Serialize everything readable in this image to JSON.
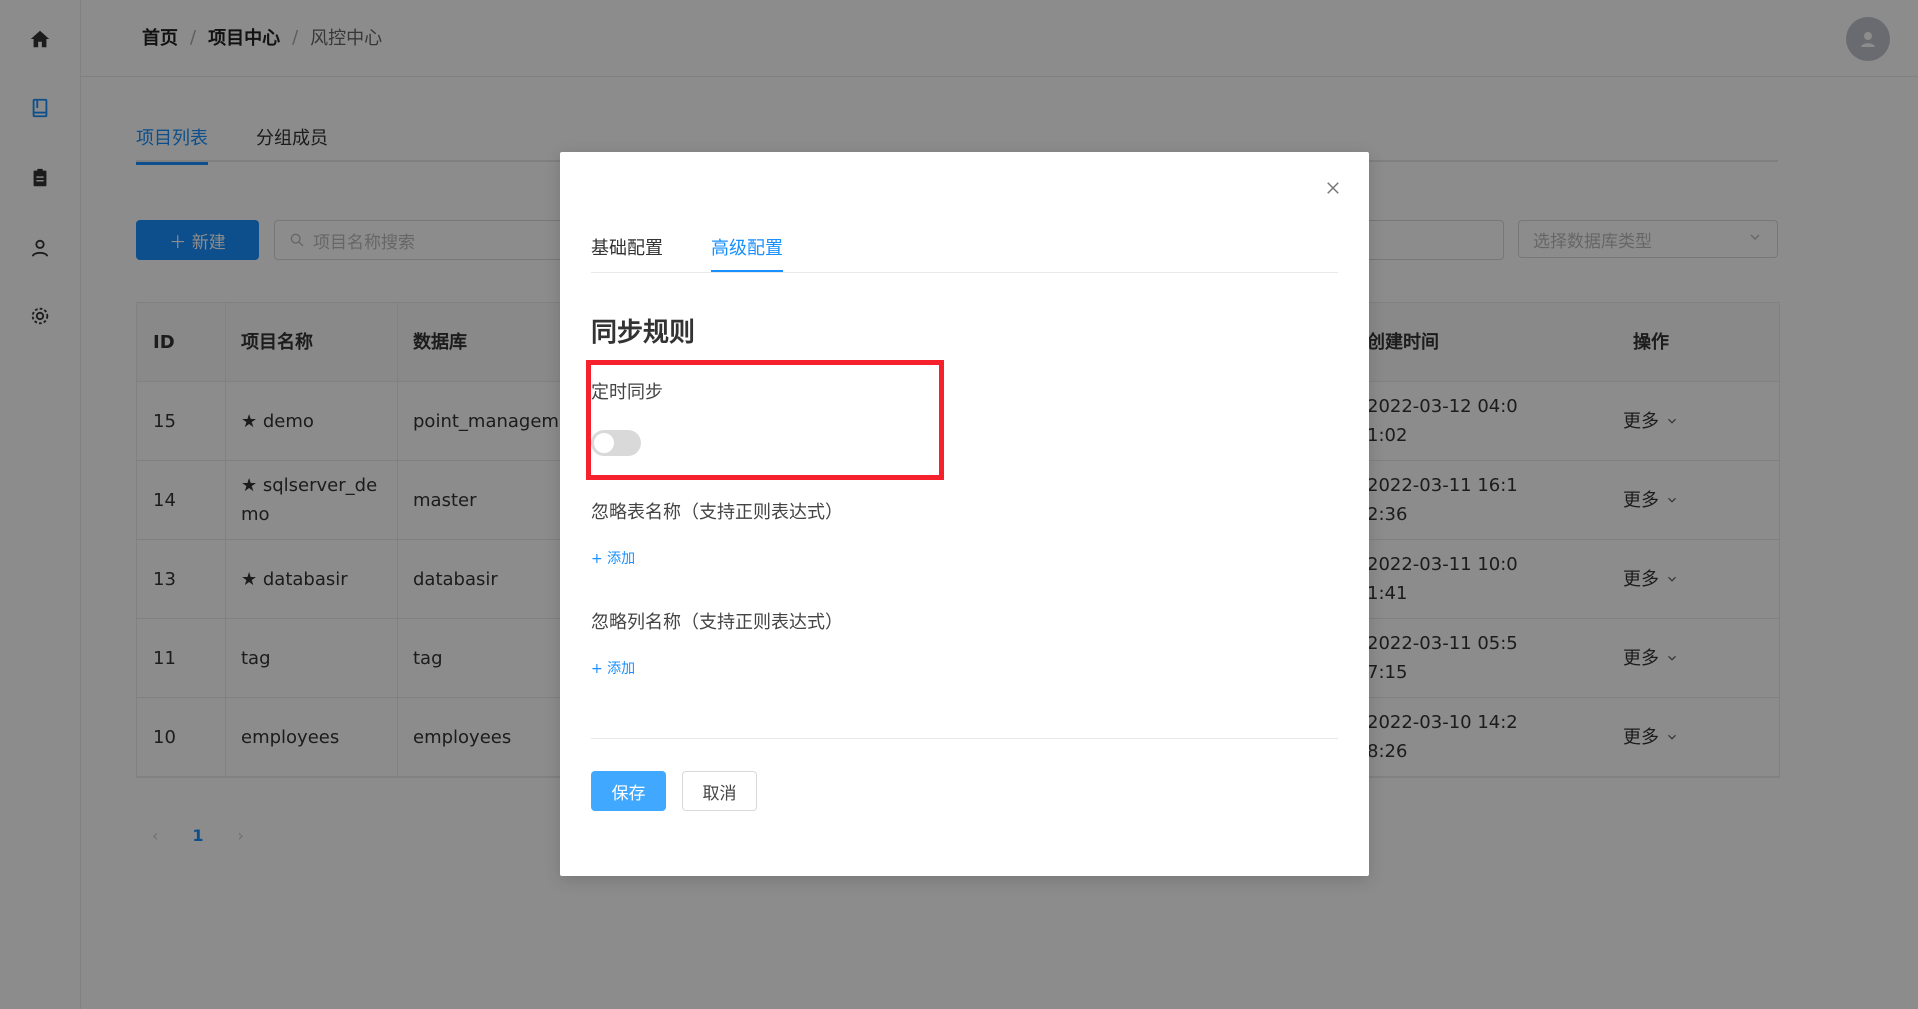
{
  "sidebar": {
    "items": [
      {
        "icon": "home-icon"
      },
      {
        "icon": "book-icon"
      },
      {
        "icon": "clipboard-icon"
      },
      {
        "icon": "user-icon"
      },
      {
        "icon": "gear-icon"
      }
    ],
    "active_color": "#1890ff"
  },
  "breadcrumb": {
    "items": [
      "首页",
      "项目中心",
      "风控中心"
    ],
    "separator": "/"
  },
  "header": {
    "avatar_icon": "user-avatar-icon"
  },
  "main_tabs": [
    "项目列表",
    "分组成员"
  ],
  "toolbar": {
    "new_button": "＋ 新建",
    "search_placeholder": "项目名称搜索",
    "db_type_placeholder": "选择数据库类型"
  },
  "table": {
    "columns": [
      "ID",
      "项目名称",
      "数据库",
      "创建时间",
      "操作"
    ],
    "rows": [
      {
        "id": "15",
        "name": "★ demo",
        "db": "point_manageme",
        "time": "2022-03-12 04:0\n1:02",
        "op": "更多"
      },
      {
        "id": "14",
        "name": "★ sqlserver_de\nmo",
        "db": "master",
        "time": "2022-03-11 16:1\n2:36",
        "op": "更多"
      },
      {
        "id": "13",
        "name": "★ databasir",
        "db": "databasir",
        "time": "2022-03-11 10:0\n1:41",
        "op": "更多"
      },
      {
        "id": "11",
        "name": "tag",
        "db": "tag",
        "time": "2022-03-11 05:5\n7:15",
        "op": "更多"
      },
      {
        "id": "10",
        "name": "employees",
        "db": "employees",
        "time": "2022-03-10 14:2\n8:26",
        "op": "更多"
      }
    ]
  },
  "pagination": {
    "current": "1",
    "prev": "‹",
    "next": "›"
  },
  "modal": {
    "tabs": [
      "基础配置",
      "高级配置"
    ],
    "active_tab": 1,
    "section_title": "同步规则",
    "schedule_label": "定时同步",
    "schedule_enabled": false,
    "ignore_tables_label": "忽略表名称（支持正则表达式）",
    "ignore_columns_label": "忽略列名称（支持正则表达式）",
    "add_label": "+ 添加",
    "save_button": "保存",
    "cancel_button": "取消",
    "highlight_color": "#f5222d"
  }
}
